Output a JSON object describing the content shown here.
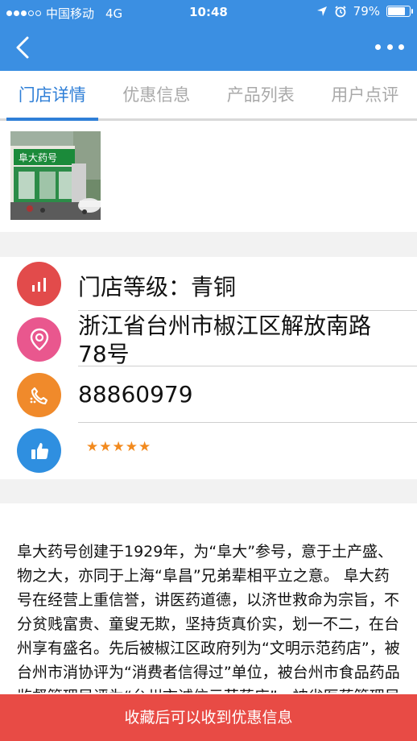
{
  "status_bar": {
    "carrier": "中国移动",
    "network": "4G",
    "time": "10:48",
    "battery_percent": "79%",
    "battery_level": 0.79,
    "signal_bars": 3
  },
  "navbar": {
    "back_icon": "chevron-left-icon",
    "more_icon": "more-dots-icon"
  },
  "tabs": [
    {
      "label": "门店详情",
      "active": true
    },
    {
      "label": "优惠信息",
      "active": false
    },
    {
      "label": "产品列表",
      "active": false
    },
    {
      "label": "用户点评",
      "active": false
    }
  ],
  "store": {
    "photo_sign_text": "阜大药号"
  },
  "info": {
    "level": "门店等级：青铜",
    "address": "浙江省台州市椒江区解放南路78号",
    "phone": "88860979",
    "rating_stars": 5
  },
  "icons": {
    "level": {
      "name": "bar-chart-icon",
      "color": "#e24b4b"
    },
    "address": {
      "name": "location-pin-icon",
      "color": "#e9578e"
    },
    "phone": {
      "name": "phone-icon",
      "color": "#f08a2b"
    },
    "rating": {
      "name": "thumbs-up-icon",
      "color": "#2f8fe0"
    }
  },
  "description": "阜大药号创建于1929年，为“阜大”参号，意于土产盛、物之大，亦同于上海“阜昌”兄弟辈相平立之意。 阜大药号在经营上重信誉，讲医药道德，以济世救命为宗旨，不分贫贱富贵、童叟无欺，坚持货真价实，划一不二，在台州享有盛名。先后被椒江区政府列为“文明示范药店”，被台州市消协评为“消费者信得过”单位，被台州市食品药品监督管理局评为“台州市诚信示范药店”，被省医药管理局授予“省级文明",
  "bottom_button": {
    "label": "收藏后可以收到优惠信息"
  }
}
